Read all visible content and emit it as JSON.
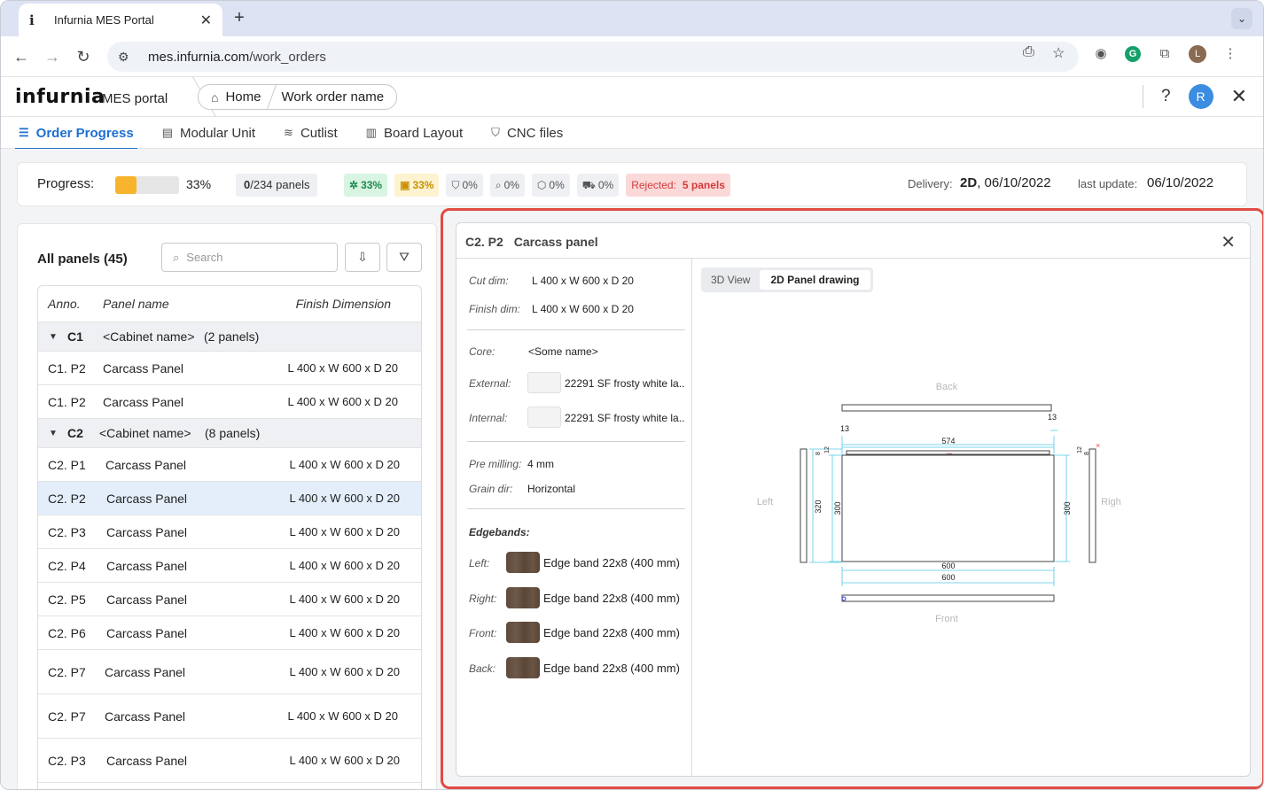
{
  "browser": {
    "tab_title": "Infurnia MES Portal",
    "tab_favicon": "i",
    "url_host": "mes.infurnia.com",
    "url_path": "/work_orders",
    "profile_initial": "L"
  },
  "header": {
    "logo": "infurnia",
    "portal": "MES portal",
    "breadcrumb": [
      "Home",
      "Work order name"
    ],
    "user_initial": "R"
  },
  "nav": {
    "tabs": [
      {
        "label": "Order Progress",
        "icon": "list-icon",
        "active": true
      },
      {
        "label": "Modular Unit",
        "icon": "module-icon",
        "active": false
      },
      {
        "label": "Cutlist",
        "icon": "cutlist-icon",
        "active": false
      },
      {
        "label": "Board Layout",
        "icon": "board-layout-icon",
        "active": false
      },
      {
        "label": "CNC files",
        "icon": "cnc-icon",
        "active": false
      }
    ]
  },
  "progress": {
    "label": "Progress:",
    "fraction": 0.33,
    "pct_text": "33%",
    "panels_done": "0",
    "panels_total": "/234 panels",
    "chips": [
      "33%",
      "33%",
      "0%",
      "0%",
      "0%",
      "0%"
    ],
    "rejected_label": "Rejected:",
    "rejected_value": "5 panels",
    "delivery_label": "Delivery:",
    "delivery_bold": "2D",
    "delivery_date": ", 06/10/2022",
    "last_update_label": "last update:",
    "last_update_value": "06/10/2022"
  },
  "panel_list": {
    "title": "All panels (45)",
    "search_placeholder": "Search",
    "columns": [
      "Anno.",
      "Panel name",
      "Finish Dimension"
    ],
    "groups": [
      {
        "id": "C1",
        "name": "<Cabinet name>",
        "count": "(2 panels)"
      },
      {
        "id": "C2",
        "name": "<Cabinet name>",
        "count": "(8 panels)"
      }
    ],
    "rows": [
      {
        "anno": "C1. P2",
        "name": "Carcass Panel",
        "dim": "L 400 x W 600 x D 20"
      },
      {
        "anno": "C1. P2",
        "name": "Carcass Panel",
        "dim": "L 400 x W 600 x D 20"
      },
      {
        "anno": "C2. P1",
        "name": "Carcass Panel",
        "dim": "L 400 x W 600 x D 20"
      },
      {
        "anno": "C2. P2",
        "name": "Carcass Panel",
        "dim": "L 400 x W 600 x D 20"
      },
      {
        "anno": "C2. P3",
        "name": "Carcass Panel",
        "dim": "L 400 x W 600 x D 20"
      },
      {
        "anno": "C2. P4",
        "name": "Carcass Panel",
        "dim": "L 400 x W 600 x D 20"
      },
      {
        "anno": "C2. P5",
        "name": "Carcass Panel",
        "dim": "L 400 x W 600 x D 20"
      },
      {
        "anno": "C2. P6",
        "name": "Carcass Panel",
        "dim": "L 400 x W 600 x D 20"
      },
      {
        "anno": "C2. P7",
        "name": "Carcass Panel",
        "dim": "L 400 x W 600 x D 20"
      },
      {
        "anno": "C2. P7",
        "name": "Carcass Panel",
        "dim": "L 400 x W 600 x D 20"
      },
      {
        "anno": "C2. P3",
        "name": "Carcass Panel",
        "dim": "L 400 x W 600 x D 20"
      }
    ]
  },
  "detail": {
    "panel_id": "C2. P2",
    "panel_name": "Carcass panel",
    "cut_dim_label": "Cut dim:",
    "cut_dim": "L 400 x W 600 x D 20",
    "finish_dim_label": "Finish dim:",
    "finish_dim": "L 400 x W 600 x D 20",
    "core_label": "Core:",
    "core": "<Some name>",
    "external_label": "External:",
    "external": "22291 SF frosty white la..",
    "internal_label": "Internal:",
    "internal": "22291 SF frosty white la..",
    "pre_milling_label": "Pre milling:",
    "pre_milling": "4 mm",
    "grain_label": "Grain dir:",
    "grain": "Horizontal",
    "edgebands_title": "Edgebands:",
    "edgebands": [
      {
        "side": "Left:",
        "value": "Edge band 22x8 (400 mm)"
      },
      {
        "side": "Right:",
        "value": "Edge band 22x8 (400 mm)"
      },
      {
        "side": "Front:",
        "value": "Edge band 22x8 (400 mm)"
      },
      {
        "side": "Back:",
        "value": "Edge band 22x8 (400 mm)"
      }
    ],
    "view_tabs": [
      "3D View",
      "2D Panel drawing"
    ],
    "drawing": {
      "back": "Back",
      "front": "Front",
      "left": "Left",
      "right": "Right",
      "dim_top": "574",
      "dim_bottom_1": "600",
      "dim_bottom_2": "600",
      "dim_left_outer": "320",
      "dim_left_inner": "300",
      "dim_right": "300",
      "dim_13_left": "13",
      "dim_13_right": "13",
      "dim_small_a": "8",
      "dim_small_b": "12"
    }
  }
}
